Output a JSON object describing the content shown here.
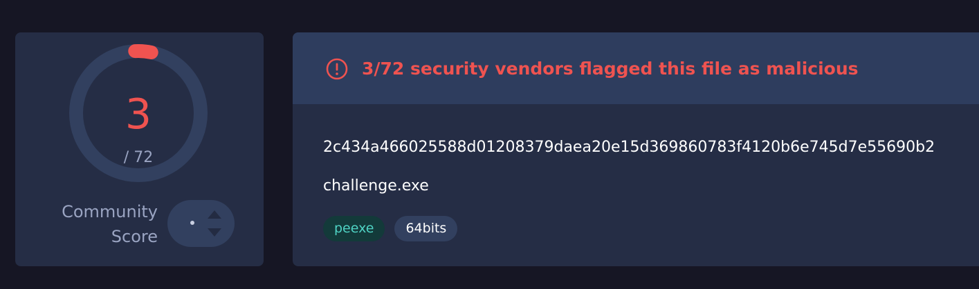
{
  "community_score": {
    "detected": "3",
    "total": "/ 72",
    "detected_fraction": 0.0417,
    "label_line1": "Community",
    "label_line2": "Score",
    "vote_up_icon": "chevron-up-icon",
    "vote_down_icon": "chevron-down-icon"
  },
  "alert": {
    "icon": "alert-circle-icon",
    "text": "3/72 security vendors flagged this file as malicious"
  },
  "file": {
    "hash": "2c434a466025588d01208379daea20e15d369860783f4120b6e745d7e55690b2",
    "name": "challenge.exe",
    "tags": [
      "peexe",
      "64bits"
    ]
  },
  "colors": {
    "background": "#161624",
    "card": "#252d45",
    "banner": "#2e3d5e",
    "malicious": "#ef5350",
    "tag_peexe_bg": "#133a3a",
    "tag_peexe_text": "#4fd3c4",
    "muted_text": "#9aa4c2"
  }
}
